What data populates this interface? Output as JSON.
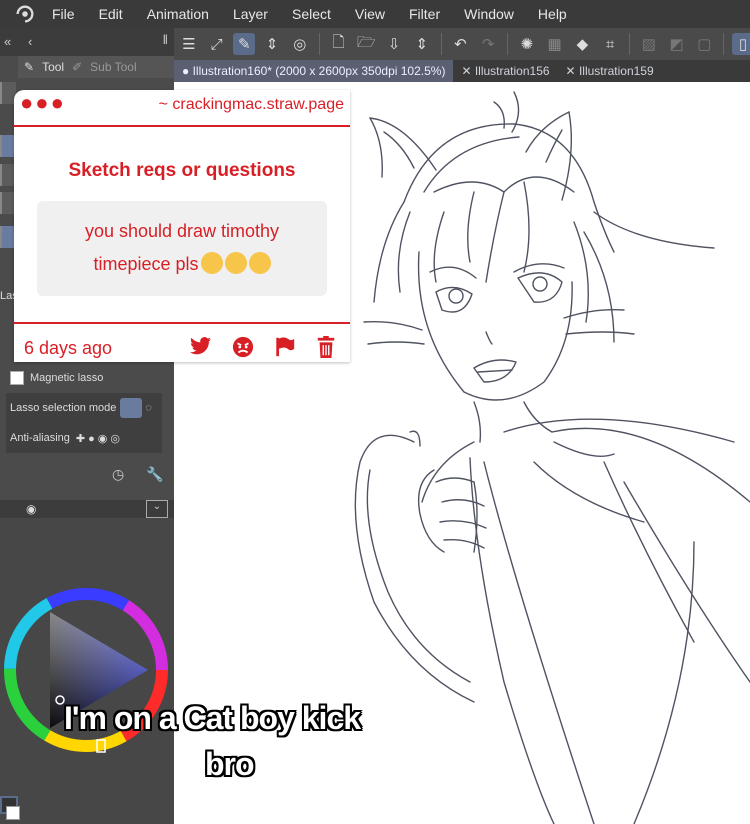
{
  "menu": [
    "File",
    "Edit",
    "Animation",
    "Layer",
    "Select",
    "View",
    "Filter",
    "Window",
    "Help"
  ],
  "tabs": [
    "Illustration160* (2000 x 2600px 350dpi 102.5%)",
    "Illustration156",
    "Illustration159"
  ],
  "tool_panel": {
    "tool_tab": "Tool",
    "sub_tool_tab": "Sub Tool",
    "lasso_label": "Las",
    "magnetic_lasso": "Magnetic lasso",
    "lasso_mode_label": "Lasso selection mode",
    "anti_aliasing_label": "Anti-aliasing"
  },
  "card": {
    "dots": "●●●",
    "site": "~ crackingmac.straw.page",
    "title": "Sketch reqs or questions",
    "message_line1": "you should draw timothy",
    "message_line2": "timepiece pls",
    "time": "6 days ago"
  },
  "caption": {
    "line1": "I'm on a Cat boy kick",
    "line2": "bro"
  },
  "colors": {
    "accent": "#d81f26",
    "ui_dark": "#3a3a3a",
    "ui_panel": "#4b4b4b"
  }
}
